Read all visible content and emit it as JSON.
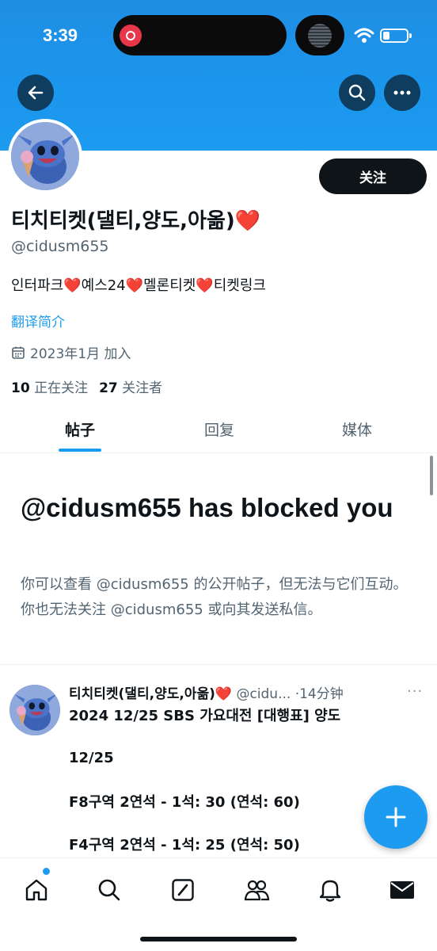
{
  "status": {
    "time": "3:39"
  },
  "header": {
    "back_icon": "arrow-left-icon",
    "search_icon": "search-icon",
    "more_icon": "more-horizontal-icon"
  },
  "profile": {
    "display_name": "티치티켓(댈티,양도,아옮)❤️",
    "handle": "@cidusm655",
    "follow_label": "关注",
    "bio": "인터파크❤️예스24❤️멜론티켓❤️티켓링크",
    "translate_label": "翻译简介",
    "joined": "2023年1月 加入",
    "following_count": "10",
    "following_label": "正在关注",
    "followers_count": "27",
    "followers_label": "关注者"
  },
  "tabs": [
    {
      "label": "帖子",
      "active": true
    },
    {
      "label": "回复",
      "active": false
    },
    {
      "label": "媒体",
      "active": false
    }
  ],
  "blocked": {
    "title": "@cidusm655 has blocked you",
    "description": "你可以查看 @cidusm655 的公开帖子，但无法与它们互动。你也无法关注 @cidusm655 或向其发送私信。"
  },
  "post": {
    "author": "티치티켓(댈티,양도,아옮)❤️",
    "handle": "@cidu...",
    "time": "·14分钟",
    "more": "···",
    "lines": [
      "2024 12/25 SBS 가요대전 [대행표] 양도",
      "12/25",
      "F8구역 2연석 - 1석: 30 (연석: 60)",
      "F4구역 2연석 - 1석: 25 (연석: 50)"
    ]
  },
  "fab": {
    "icon": "plus-icon"
  },
  "bottom_nav": [
    {
      "name": "home",
      "icon": "home-icon"
    },
    {
      "name": "explore",
      "icon": "search-icon"
    },
    {
      "name": "grok",
      "icon": "grok-icon"
    },
    {
      "name": "communities",
      "icon": "people-icon"
    },
    {
      "name": "notifications",
      "icon": "bell-icon"
    },
    {
      "name": "messages",
      "icon": "envelope-icon"
    }
  ],
  "colors": {
    "accent": "#1d9bf0",
    "text": "#0f1419",
    "muted": "#536471"
  }
}
